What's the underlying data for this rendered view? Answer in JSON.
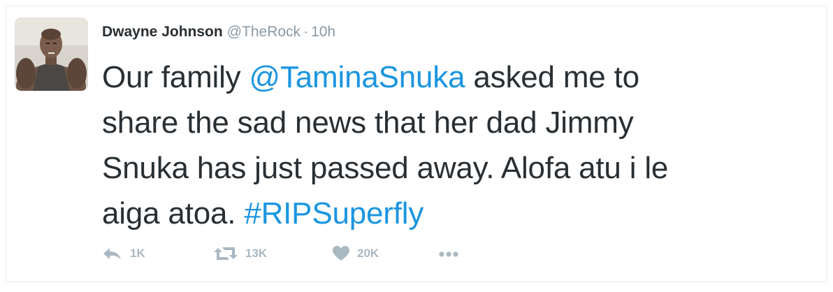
{
  "tweet": {
    "author": {
      "name": "Dwayne Johnson",
      "handle": "@TheRock",
      "separator": "·",
      "time": "10h"
    },
    "text": {
      "l1_pre": "Our family ",
      "l1_mention": "@TaminaSnuka",
      "l1_post": " asked me to",
      "l2": "share the sad news that her dad Jimmy",
      "l3": "Snuka has just passed away. Alofa atu i le",
      "l4_pre": "aiga atoa. ",
      "l4_hashtag": "#RIPSuperfly"
    },
    "actions": {
      "reply": {
        "icon": "reply-icon",
        "count": "1K"
      },
      "retweet": {
        "icon": "retweet-icon",
        "count": "13K"
      },
      "like": {
        "icon": "heart-icon",
        "count": "20K"
      },
      "more": {
        "icon": "more-dots-icon"
      }
    }
  },
  "colors": {
    "text": "#292f33",
    "muted": "#8899a6",
    "link": "#1b95e0",
    "action_gray": "#aab8c2",
    "border": "#e1e8ed"
  }
}
